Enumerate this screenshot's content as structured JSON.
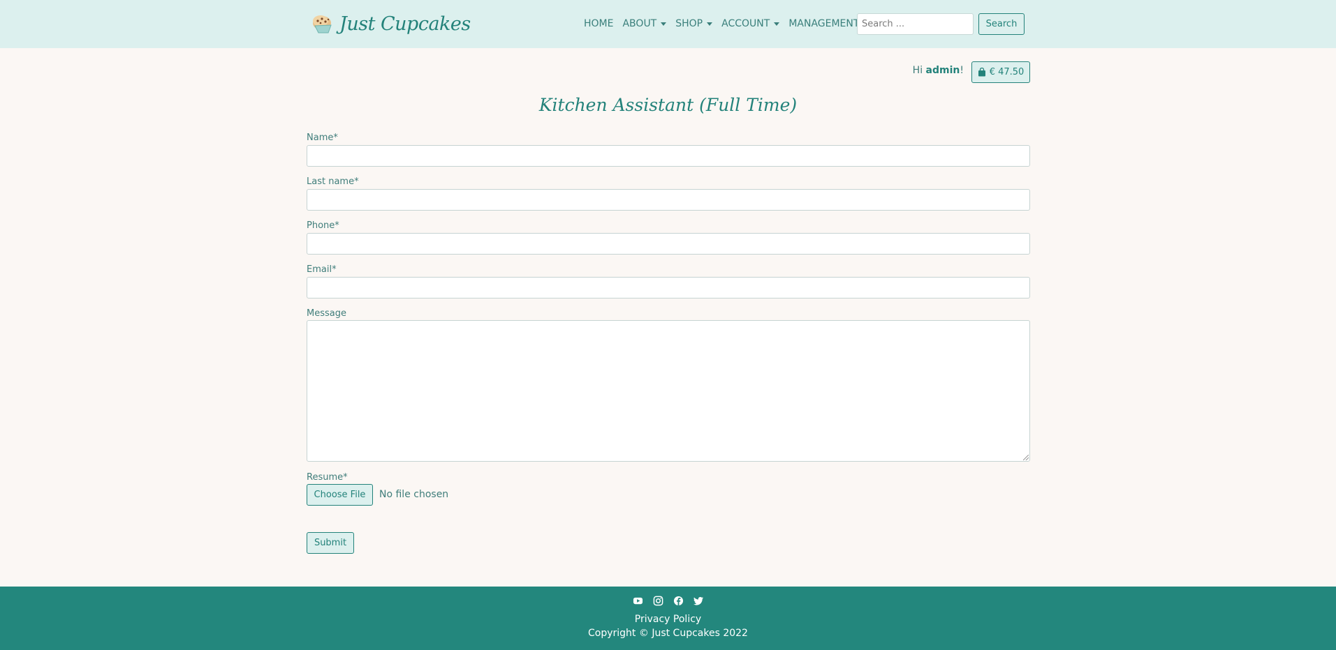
{
  "navbar": {
    "brand": "Just Cupcakes",
    "items": [
      {
        "label": "HOME",
        "dropdown": false
      },
      {
        "label": "ABOUT",
        "dropdown": true
      },
      {
        "label": "SHOP",
        "dropdown": true
      },
      {
        "label": "ACCOUNT",
        "dropdown": true
      },
      {
        "label": "MANAGEMENT",
        "dropdown": false
      }
    ],
    "search_placeholder": "Search ...",
    "search_button": "Search"
  },
  "user": {
    "greeting_prefix": "Hi ",
    "username": "admin",
    "greeting_suffix": "!",
    "cart_total": "€ 47.50"
  },
  "page": {
    "title": "Kitchen Assistant (Full Time)"
  },
  "form": {
    "name_label": "Name*",
    "last_name_label": "Last name*",
    "phone_label": "Phone*",
    "email_label": "Email*",
    "message_label": "Message",
    "resume_label": "Resume*",
    "choose_file": "Choose File",
    "file_status": "No file chosen",
    "submit": "Submit"
  },
  "footer": {
    "social_icons": [
      "youtube-icon",
      "instagram-icon",
      "facebook-icon",
      "twitter-icon"
    ],
    "privacy": "Privacy Policy",
    "copyright": "Copyright © Just Cupcakes 2022"
  },
  "colors": {
    "navbar_bg": "#dcf0ee",
    "page_bg": "#fbf7f4",
    "accent": "#23827a",
    "footer_bg": "#23877d"
  }
}
